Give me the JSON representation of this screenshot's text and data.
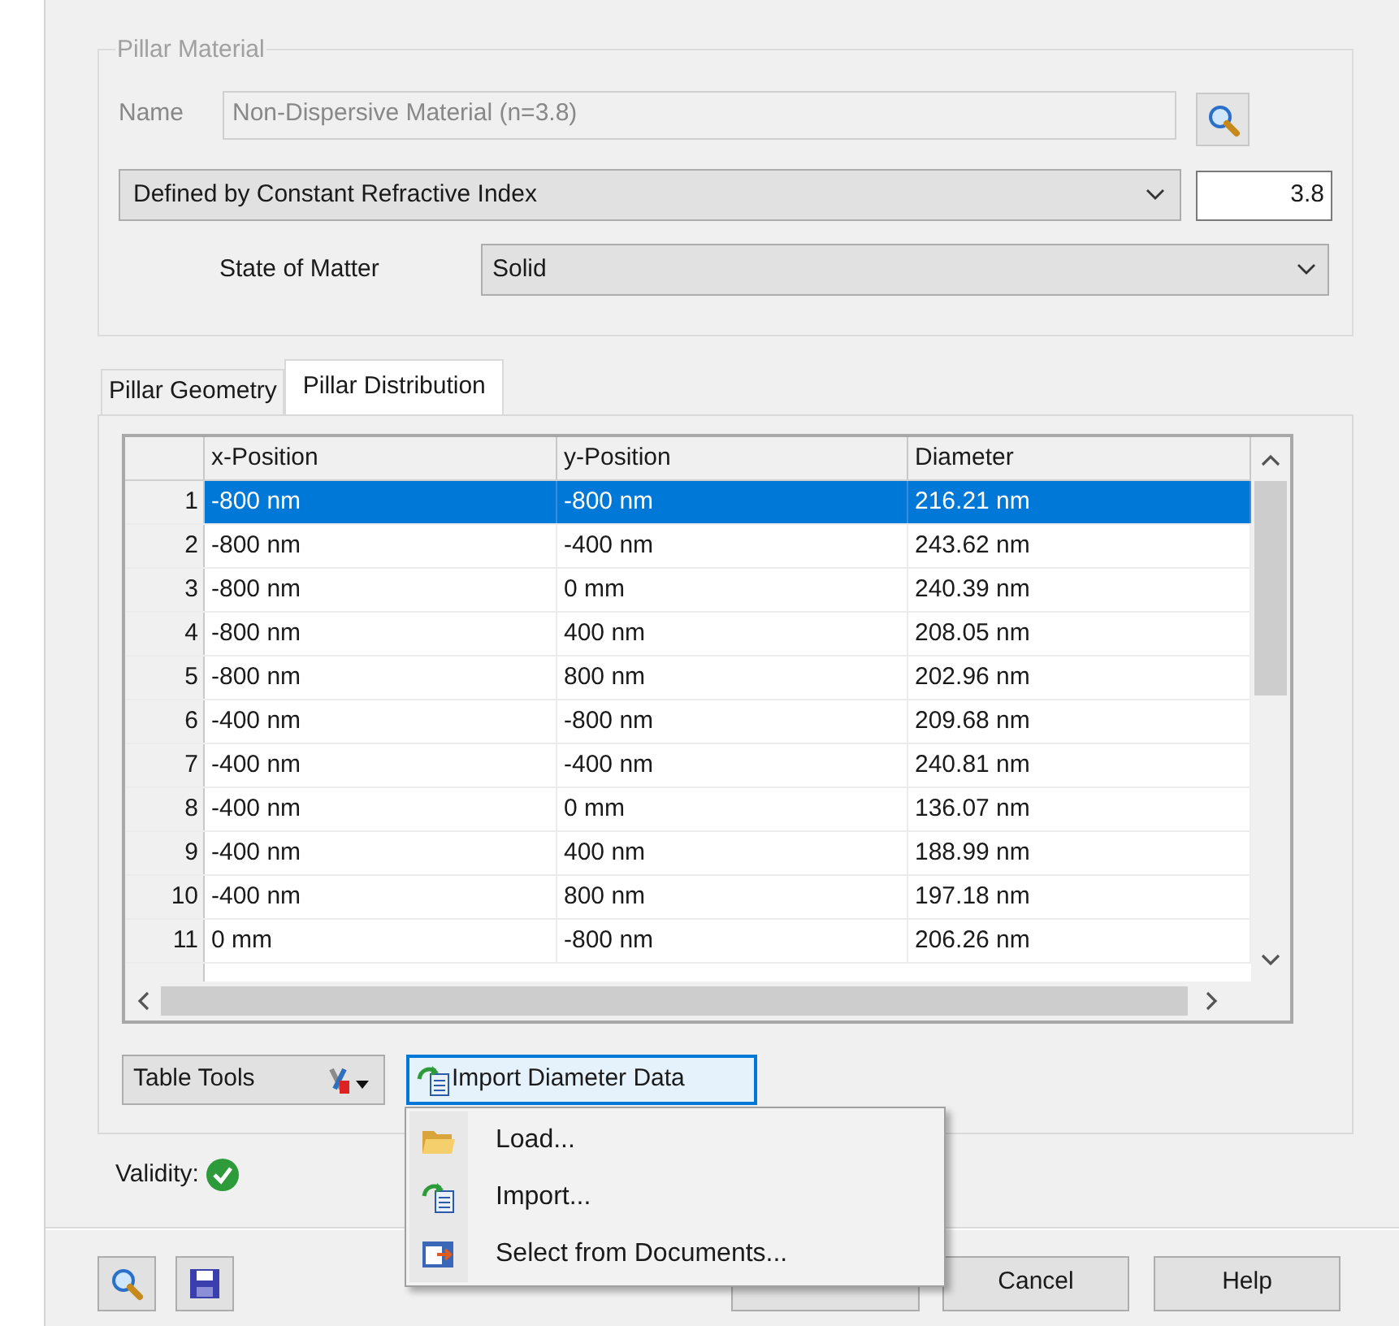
{
  "material": {
    "legend": "Pillar Material",
    "name_label": "Name",
    "name_value": "Non-Dispersive Material (n=3.8)",
    "definition": "Defined by Constant Refractive Index",
    "index_value": "3.8",
    "state_label": "State of Matter",
    "state_value": "Solid"
  },
  "tabs": [
    {
      "label": "Pillar Geometry",
      "selected": false
    },
    {
      "label": "Pillar Distribution",
      "selected": true
    }
  ],
  "table": {
    "columns": [
      "x-Position",
      "y-Position",
      "Diameter"
    ],
    "rows": [
      {
        "index": "1",
        "cells": [
          "-800 nm",
          "-800 nm",
          "216.21 nm"
        ],
        "selected": true
      },
      {
        "index": "2",
        "cells": [
          "-800 nm",
          "-400 nm",
          "243.62 nm"
        ],
        "selected": false
      },
      {
        "index": "3",
        "cells": [
          "-800 nm",
          "0 mm",
          "240.39 nm"
        ],
        "selected": false
      },
      {
        "index": "4",
        "cells": [
          "-800 nm",
          "400 nm",
          "208.05 nm"
        ],
        "selected": false
      },
      {
        "index": "5",
        "cells": [
          "-800 nm",
          "800 nm",
          "202.96 nm"
        ],
        "selected": false
      },
      {
        "index": "6",
        "cells": [
          "-400 nm",
          "-800 nm",
          "209.68 nm"
        ],
        "selected": false
      },
      {
        "index": "7",
        "cells": [
          "-400 nm",
          "-400 nm",
          "240.81 nm"
        ],
        "selected": false
      },
      {
        "index": "8",
        "cells": [
          "-400 nm",
          "0 mm",
          "136.07 nm"
        ],
        "selected": false
      },
      {
        "index": "9",
        "cells": [
          "-400 nm",
          "400 nm",
          "188.99 nm"
        ],
        "selected": false
      },
      {
        "index": "10",
        "cells": [
          "-400 nm",
          "800 nm",
          "197.18 nm"
        ],
        "selected": false
      },
      {
        "index": "11",
        "cells": [
          "0 mm",
          "-800 nm",
          "206.26 nm"
        ],
        "selected": false
      }
    ]
  },
  "table_tools": "Table Tools",
  "import_button": "Import Diameter Data",
  "menu": [
    {
      "label": "Load...",
      "kind": "folder"
    },
    {
      "label": "Import...",
      "kind": "import"
    },
    {
      "label": "Select from Documents...",
      "kind": "documents"
    }
  ],
  "validity": {
    "label": "Validity:",
    "valid": true
  },
  "buttons": [
    "Cancel",
    "Help"
  ]
}
